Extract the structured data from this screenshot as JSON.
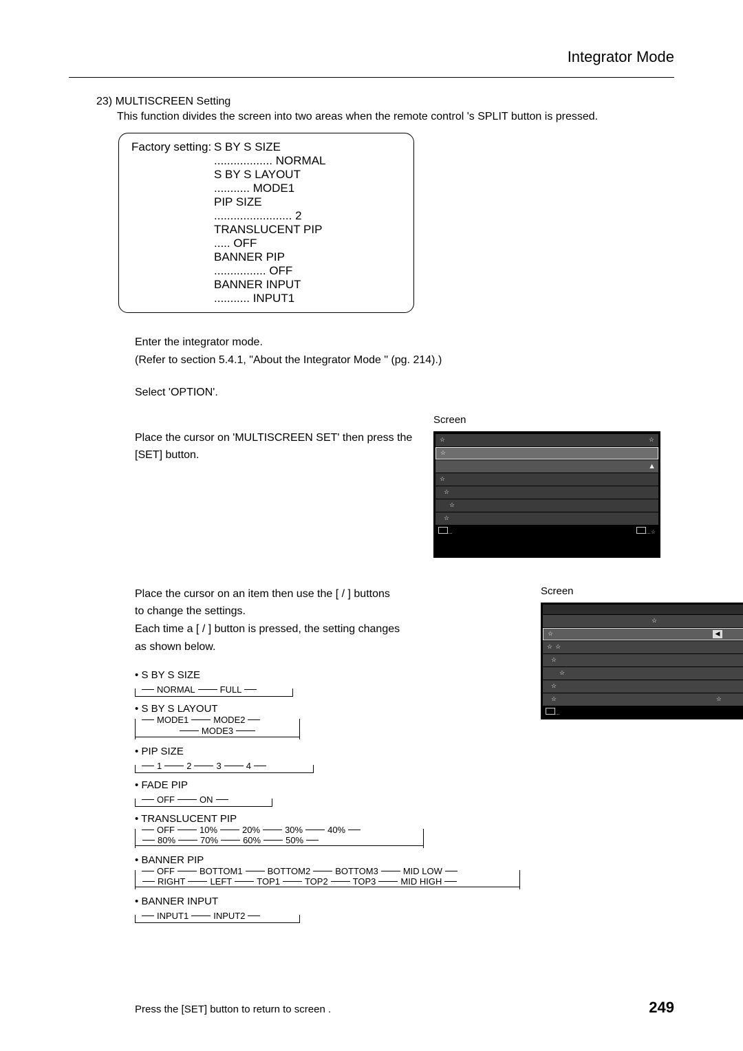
{
  "header": {
    "title": "Integrator Mode"
  },
  "section": {
    "number": "23)",
    "title": "MULTISCREEN Setting",
    "description": "This function divides the screen into two areas when the remote control 's SPLIT button is pressed."
  },
  "factory": {
    "label": "Factory setting:",
    "rows": [
      {
        "item": "S BY S SIZE",
        "dots": "..................",
        "value": "NORMAL"
      },
      {
        "item": "S BY S LAYOUT",
        "dots": "...........",
        "value": "MODE1"
      },
      {
        "item": "PIP SIZE",
        "dots": "........................",
        "value": "2"
      },
      {
        "item": "TRANSLUCENT PIP",
        "dots": ".....",
        "value": "OFF"
      },
      {
        "item": "BANNER PIP",
        "dots": "................",
        "value": "OFF"
      },
      {
        "item": "BANNER INPUT",
        "dots": "...........",
        "value": "INPUT1"
      }
    ]
  },
  "steps": {
    "s1_l1": "Enter the integrator mode.",
    "s1_l2": "(Refer to section 5.4.1, \"About the Integrator Mode \" (pg. 214).)",
    "s2": "Select 'OPTION'.",
    "s3_l1": "Place the cursor on 'MULTISCREEN SET' then press the",
    "s3_l2": "[SET] button.",
    "s4_l1": "Place the cursor on an item then use the [   /   ] buttons",
    "s4_l2": "to change the settings.",
    "s4_l3": "Each time a [   /   ] button is pressed, the setting changes",
    "s4_l4": "as shown below.",
    "screen_label": "Screen",
    "footer": "Press the [SET] button to return to screen    ."
  },
  "params": {
    "sbys_size": {
      "title": "S BY S SIZE",
      "opts": [
        "NORMAL",
        "FULL"
      ]
    },
    "sbys_layout": {
      "title": "S BY S LAYOUT",
      "opts": [
        "MODE1",
        "MODE2",
        "MODE3"
      ]
    },
    "pip_size": {
      "title": "PIP SIZE",
      "opts": [
        "1",
        "2",
        "3",
        "4"
      ]
    },
    "fade_pip": {
      "title": "FADE PIP",
      "opts": [
        "OFF",
        "ON"
      ]
    },
    "translucent": {
      "title": "TRANSLUCENT PIP",
      "row1": [
        "OFF",
        "10%",
        "20%",
        "30%",
        "40%"
      ],
      "row2": [
        "80%",
        "70%",
        "60%",
        "50%"
      ]
    },
    "banner_pip": {
      "title": "BANNER PIP",
      "row1": [
        "OFF",
        "BOTTOM1",
        "BOTTOM2",
        "BOTTOM3",
        "MID LOW"
      ],
      "row2": [
        "RIGHT",
        "LEFT",
        "TOP1",
        "TOP2",
        "TOP3",
        "MID HIGH"
      ]
    },
    "banner_input": {
      "title": "BANNER INPUT",
      "opts": [
        "INPUT1",
        "INPUT2"
      ]
    }
  },
  "page_number": "249",
  "glyphs": {
    "bullet": "•",
    "star": "☆",
    "tri_up": "▲",
    "tri_left": "◀",
    "tri_right": "▶",
    "menu_dots": "..."
  }
}
